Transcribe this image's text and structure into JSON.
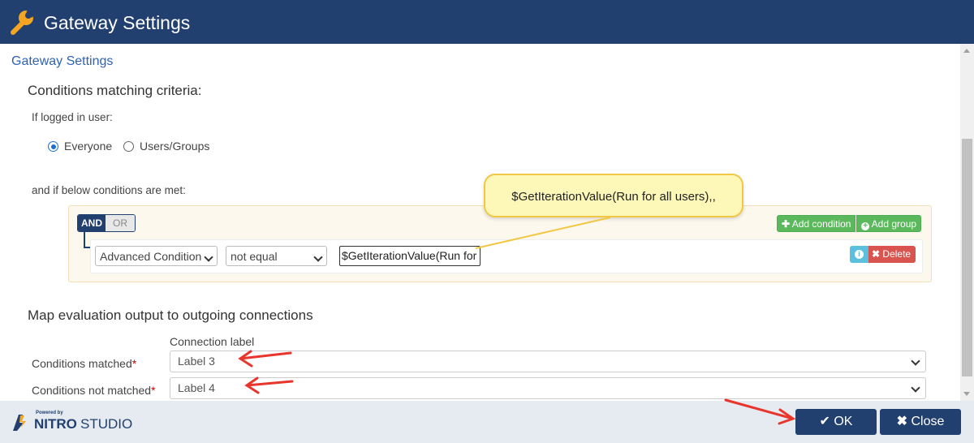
{
  "window": {
    "title": "Gateway Settings",
    "icon": "wrench-icon"
  },
  "section_title": "Gateway Settings",
  "criteria": {
    "heading": "Conditions matching criteria:",
    "logged_in_label": "If logged in user:",
    "radios": [
      {
        "label": "Everyone",
        "checked": true
      },
      {
        "label": "Users/Groups",
        "checked": false
      }
    ],
    "conditions_label": "and if below conditions are met:"
  },
  "builder": {
    "and_label": "AND",
    "or_label": "OR",
    "add_condition_label": "Add condition",
    "add_group_label": "Add group",
    "rule": {
      "field": "Advanced Condition",
      "operator": "not equal",
      "value": "$GetIterationValue(Run for"
    },
    "delete_label": "Delete"
  },
  "callout_text": "$GetIterationValue(Run for all users),,",
  "mapping": {
    "heading": "Map evaluation output to outgoing connections",
    "column_header": "Connection label",
    "rows": [
      {
        "label": "Conditions matched",
        "required_mark": "*",
        "value": "Label 3"
      },
      {
        "label": "Conditions not matched",
        "required_mark": "*",
        "value": "Label 4"
      }
    ]
  },
  "footer": {
    "brand_top": "Powered by",
    "brand_name": "NITRO",
    "brand_suffix": "STUDIO",
    "ok_label": "OK",
    "close_label": "Close"
  },
  "colors": {
    "titlebar": "#22406f",
    "link": "#2e62b5",
    "success": "#5cb85c",
    "danger": "#d9534f",
    "info": "#5bc0de",
    "annotation_arrow": "#e8362d",
    "callout_bg": "#fdf7b8"
  }
}
